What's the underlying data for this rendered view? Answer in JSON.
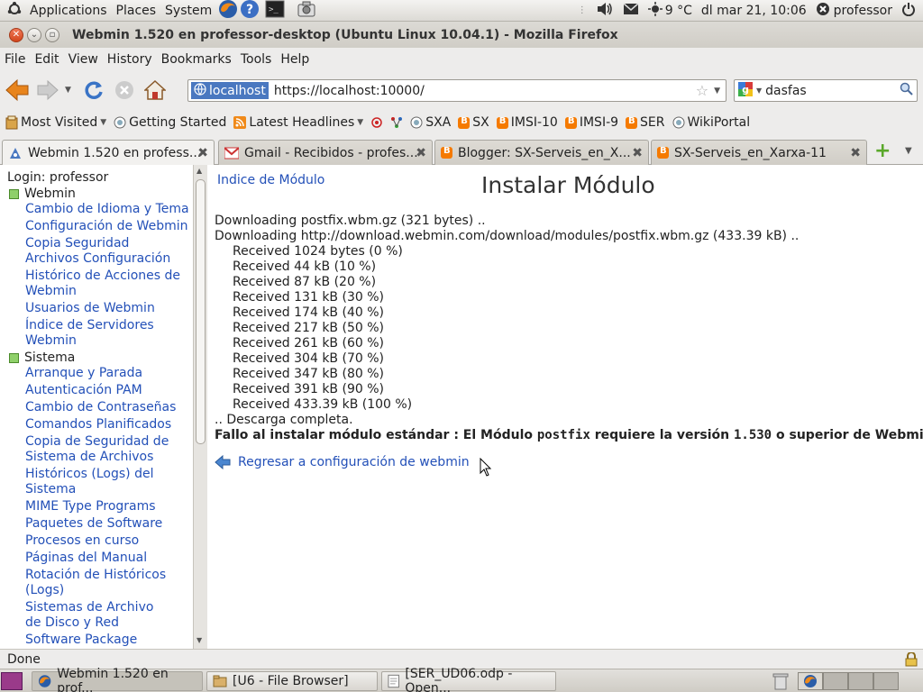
{
  "panel": {
    "applications": "Applications",
    "places": "Places",
    "system": "System",
    "weather": "9 °C",
    "datetime": "dl mar 21, 10:06",
    "user": "professor"
  },
  "window": {
    "title": "Webmin 1.520 en professor-desktop (Ubuntu Linux 10.04.1) - Mozilla Firefox"
  },
  "menubar": [
    "File",
    "Edit",
    "View",
    "History",
    "Bookmarks",
    "Tools",
    "Help"
  ],
  "navbar": {
    "identity": "localhost",
    "url": "https://localhost:10000/",
    "search_value": "dasfas"
  },
  "bookmarks": [
    "Most Visited",
    "Getting Started",
    "Latest Headlines",
    "SXA",
    "SX",
    "IMSI-10",
    "IMSI-9",
    "SER",
    "WikiPortal"
  ],
  "tabs": [
    "Webmin 1.520 en profess...",
    "Gmail - Recibidos - profes...",
    "Blogger: SX-Serveis_en_X...",
    "SX-Serveis_en_Xarxa-11"
  ],
  "sidebar": {
    "login": "Login: professor",
    "cat_webmin": "Webmin",
    "webmin_items": [
      "Cambio de Idioma y Tema",
      "Configuración de Webmin",
      "Copia Seguridad Archivos Configuración",
      "Histórico de Acciones de Webmin",
      "Usuarios de Webmin",
      "Índice de Servidores Webmin"
    ],
    "cat_sistema": "Sistema",
    "sistema_items": [
      "Arranque y Parada",
      "Autenticación PAM",
      "Cambio de Contraseñas",
      "Comandos Planificados",
      "Copia de Seguridad de Sistema de Archivos",
      "Históricos (Logs) del Sistema",
      "MIME Type Programs",
      "Paquetes de Software",
      "Procesos en curso",
      "Páginas del Manual",
      "Rotación de Históricos (Logs)",
      "Sistemas de Archivo de Disco y Red",
      "Software Package Updates"
    ]
  },
  "main": {
    "index_link": "Indice de Módulo",
    "page_title": "Instalar Módulo",
    "line1": "Downloading postfix.wbm.gz (321 bytes) ..",
    "line2": "Downloading http://download.webmin.com/download/modules/postfix.wbm.gz (433.39 kB) ..",
    "received": [
      "Received 1024 bytes (0 %)",
      "Received 44 kB (10 %)",
      "Received 87 kB (20 %)",
      "Received 131 kB (30 %)",
      "Received 174 kB (40 %)",
      "Received 217 kB (50 %)",
      "Received 261 kB (60 %)",
      "Received 304 kB (70 %)",
      "Received 347 kB (80 %)",
      "Received 391 kB (90 %)",
      "Received 433.39 kB (100 %)"
    ],
    "done": ".. Descarga completa.",
    "error_prefix": "Fallo al instalar módulo estándar : El Módulo ",
    "error_module": "postfix",
    "error_mid": " requiere la versión ",
    "error_version": "1.530",
    "error_suffix": " o superior de Webmin",
    "return_link": "Regresar a configuración de webmin"
  },
  "status": "Done",
  "taskbar": [
    "Webmin 1.520 en prof...",
    "[U6 - File Browser]",
    "[SER_UD06.odp - Open..."
  ]
}
